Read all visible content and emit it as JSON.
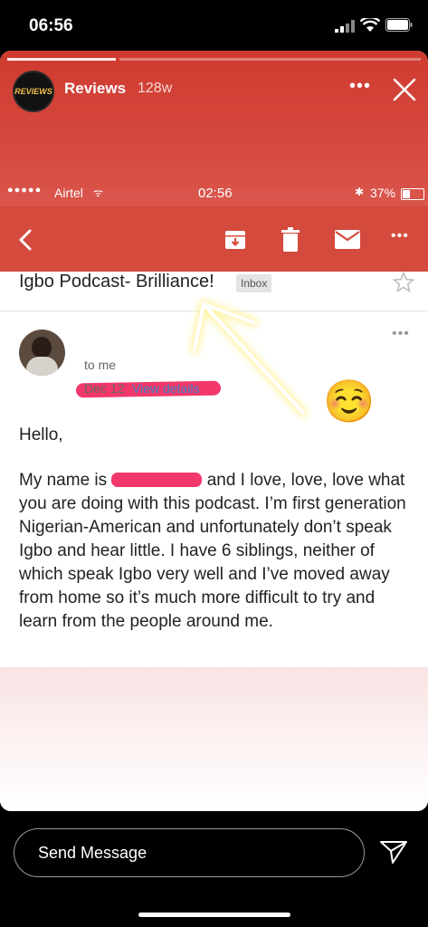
{
  "phone_status": {
    "time": "06:56"
  },
  "story": {
    "account_name": "Reviews",
    "avatar_text": "REVIEWS",
    "age": "128w",
    "progress_segments": 2
  },
  "embedded": {
    "status": {
      "carrier": "Airtel",
      "time": "02:56",
      "battery": "37%"
    },
    "email": {
      "subject": "Igbo Podcast- Brilliance!",
      "label": "Inbox",
      "to": "to me",
      "date": "Dec 12",
      "view_details": "View details",
      "greeting": "Hello,",
      "body_before": "My name is ",
      "body_after": " and I love, love, love what you are doing with this podcast. I’m first generation Nigerian-American and unfortunately don’t speak Igbo and hear little. I have 6 siblings, neither of which speak Igbo very well and I’ve moved away from home so it’s much more difficult to try and learn from the people around me."
    },
    "emoji": "☺️"
  },
  "reply": {
    "placeholder": "Send Message"
  },
  "colors": {
    "brand_red": "#d44a3d",
    "link_blue": "#3b82c4",
    "redaction_pink": "#f2386b"
  }
}
